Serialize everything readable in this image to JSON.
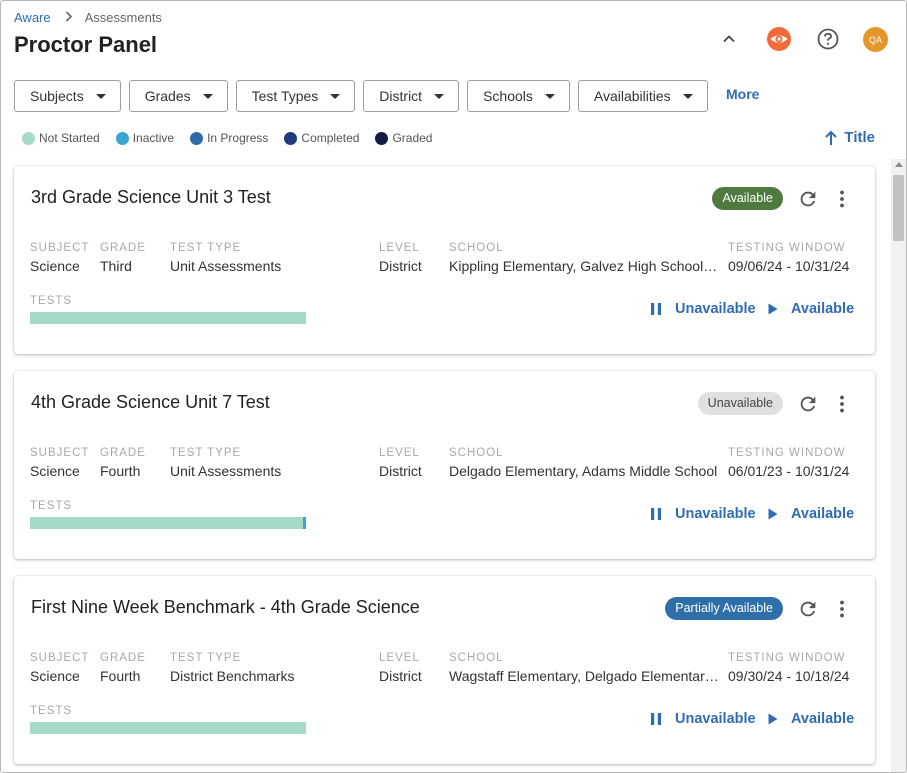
{
  "breadcrumb": {
    "root": "Aware",
    "current": "Assessments"
  },
  "page": {
    "title": "Proctor Panel"
  },
  "header": {
    "avatar_initials": "QA"
  },
  "filters": [
    "Subjects",
    "Grades",
    "Test Types",
    "District",
    "Schools",
    "Availabilities"
  ],
  "more_label": "More",
  "legend": [
    {
      "label": "Not Started",
      "color": "#a5dac9"
    },
    {
      "label": "Inactive",
      "color": "#3ba5d3"
    },
    {
      "label": "In Progress",
      "color": "#2e6aa8"
    },
    {
      "label": "Completed",
      "color": "#1f3a7d"
    },
    {
      "label": "Graded",
      "color": "#121a45"
    }
  ],
  "sort": {
    "label": "Title"
  },
  "field_labels": {
    "subject": "SUBJECT",
    "grade": "GRADE",
    "test_type": "TEST TYPE",
    "level": "LEVEL",
    "school": "SCHOOL",
    "testing_window": "TESTING WINDOW",
    "tests": "TESTS"
  },
  "actions": {
    "unavailable": "Unavailable",
    "available": "Available"
  },
  "cards": [
    {
      "title": "3rd Grade Science Unit 3 Test",
      "status": "Available",
      "status_color": "#4e7a40",
      "subject": "Science",
      "grade": "Third",
      "test_type": "Unit Assessments",
      "level": "District",
      "school": "Kippling Elementary, Galvez High School, Adams Middle School",
      "testing_window": "09/06/24 - 10/31/24",
      "inactive_fraction": 0
    },
    {
      "title": "4th Grade Science Unit 7 Test",
      "status": "Unavailable",
      "status_color": "#e0e0e0",
      "subject": "Science",
      "grade": "Fourth",
      "test_type": "Unit Assessments",
      "level": "District",
      "school": "Delgado Elementary, Adams Middle School",
      "testing_window": "06/01/23 - 10/31/24",
      "inactive_fraction": 0.01
    },
    {
      "title": "First Nine Week Benchmark - 4th Grade Science",
      "status": "Partially Available",
      "status_color": "#2f6fa9",
      "subject": "Science",
      "grade": "Fourth",
      "test_type": "District Benchmarks",
      "level": "District",
      "school": "Wagstaff Elementary, Delgado Elementary, Kippling Elementary",
      "testing_window": "09/30/24 - 10/18/24",
      "inactive_fraction": 0
    }
  ]
}
